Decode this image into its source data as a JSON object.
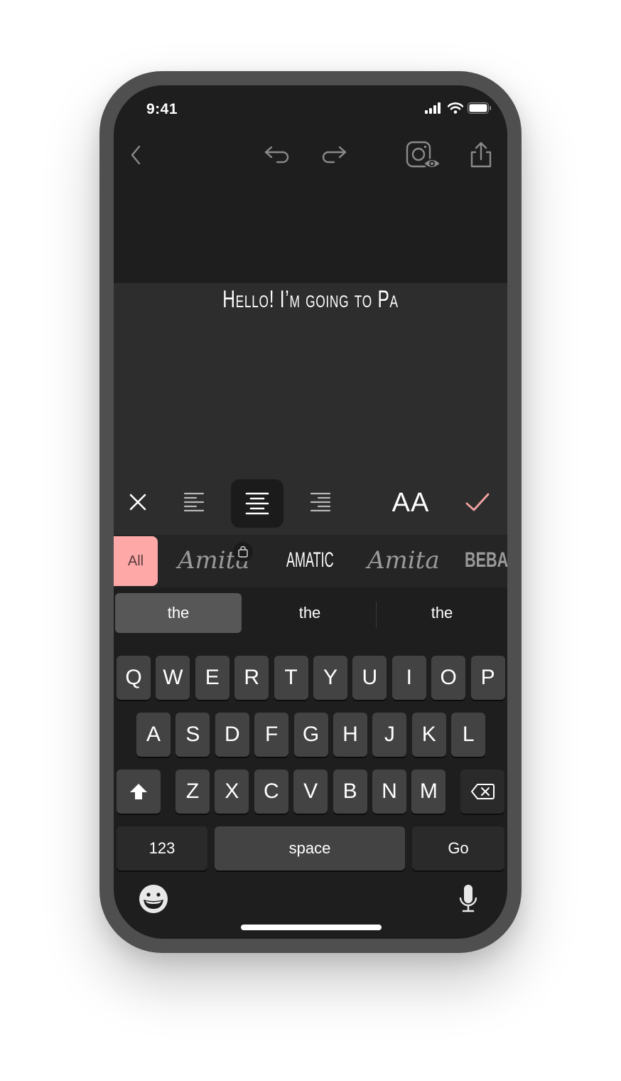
{
  "status_bar": {
    "time": "9:41"
  },
  "toolbar": {
    "icons": [
      "back-icon",
      "undo-icon",
      "redo-icon",
      "instagram-preview-icon",
      "share-icon"
    ]
  },
  "canvas": {
    "text": "Hello! I’m going to Pa"
  },
  "format_bar": {
    "close_icon": "close-icon",
    "alignments": [
      "align-left",
      "align-center",
      "align-right"
    ],
    "selected_alignment": "align-center",
    "text_size_label": "AA",
    "confirm_icon": "checkmark-icon"
  },
  "font_picker": {
    "all_label": "All",
    "fonts": [
      {
        "label": "Amita",
        "locked": true
      },
      {
        "label": "AMATIC",
        "selected": true
      },
      {
        "label": "Amita",
        "locked": false
      },
      {
        "label": "BEBAS",
        "locked": false
      }
    ]
  },
  "suggestions": [
    "the",
    "the",
    "the"
  ],
  "keyboard": {
    "row1": [
      "Q",
      "W",
      "E",
      "R",
      "T",
      "Y",
      "U",
      "I",
      "O",
      "P"
    ],
    "row2": [
      "A",
      "S",
      "D",
      "F",
      "G",
      "H",
      "J",
      "K",
      "L"
    ],
    "row3": [
      "Z",
      "X",
      "C",
      "V",
      "B",
      "N",
      "M"
    ],
    "numbers_label": "123",
    "space_label": "space",
    "go_label": "Go"
  },
  "colors": {
    "accent_pink": "#ffa8a8",
    "check_pink": "#f4a3a3",
    "screen_bg": "#1e1e1e",
    "canvas_bg": "#2d2d2d",
    "key_bg": "#434343"
  }
}
